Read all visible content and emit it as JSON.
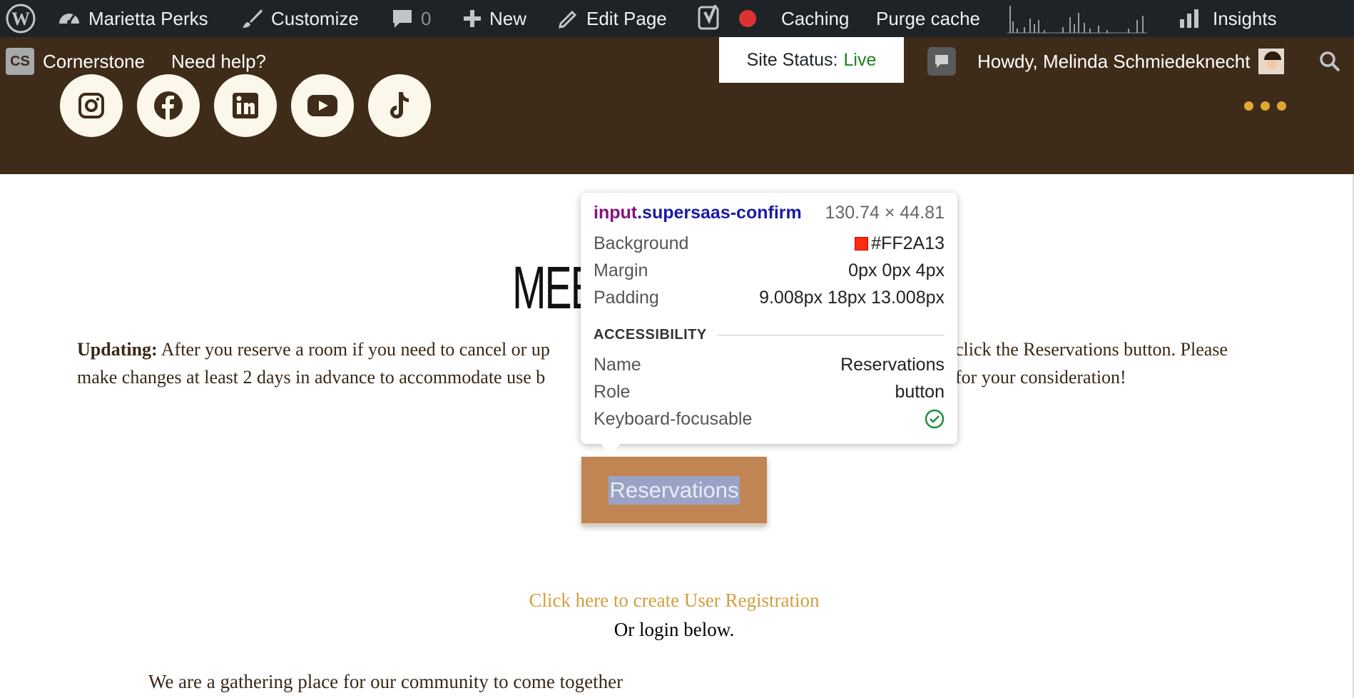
{
  "admin_bar": {
    "site_name": "Marietta Perks",
    "customize": "Customize",
    "comments_count": "0",
    "new": "New",
    "edit_page": "Edit Page",
    "caching": "Caching",
    "purge_cache": "Purge cache",
    "insights": "Insights"
  },
  "site_bar": {
    "logo_text": "CS",
    "brand": "Cornerstone",
    "help": "Need help?",
    "status_label": "Site Status:",
    "status_value": "Live",
    "howdy": "Howdy, Melinda Schmiedeknecht"
  },
  "social": [
    "instagram-icon",
    "facebook-icon",
    "linkedin-icon",
    "youtube-icon",
    "tiktok-icon"
  ],
  "tooltip": {
    "tag": "input",
    "cls": ".supersaas-confirm",
    "size": "130.74 × 44.81",
    "background_label": "Background",
    "background_value": "#FF2A13",
    "margin_label": "Margin",
    "margin_value": "0px 0px 4px",
    "padding_label": "Padding",
    "padding_value": "9.008px 18px 13.008px",
    "accessibility": "ACCESSIBILITY",
    "name_label": "Name",
    "name_value": "Reservations",
    "role_label": "Role",
    "role_value": "button",
    "keyboard_label": "Keyboard-focusable"
  },
  "main": {
    "title_visible": "MEE",
    "update_bold": "Updating:",
    "update_line1_left": "After you reserve a room if you need to cancel or up",
    "update_line1_right": "click the Reservations button. Please",
    "update_line2_left": "make changes at least 2 days in advance to accommodate use b",
    "update_line2_right": "for your consideration!",
    "reservations": "Reservations",
    "register_link": "Click here to create User Registration",
    "or_login": "Or login below.",
    "gathering": "We are a gathering place for our community to come together"
  },
  "colors": {
    "admin_bar": "#1d2327",
    "header_brown": "#3f2b19",
    "button_bg": "#c08553",
    "link_gold": "#d29e3f"
  }
}
